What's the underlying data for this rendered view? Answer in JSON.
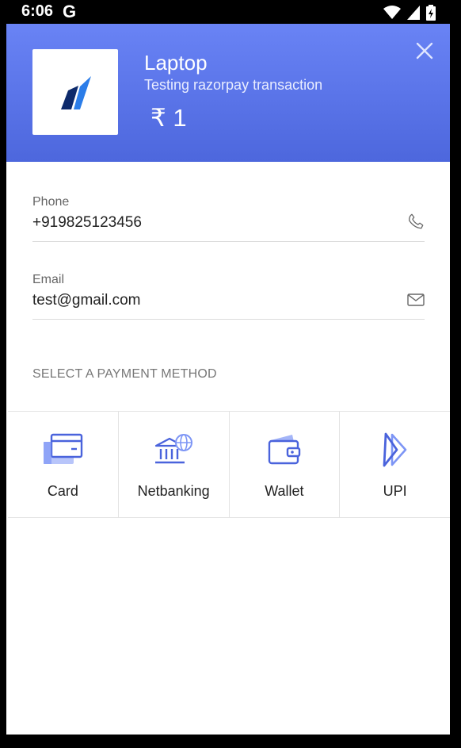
{
  "status_bar": {
    "time": "6:06",
    "g_logo": "G"
  },
  "header": {
    "product_name": "Laptop",
    "description": "Testing razorpay transaction",
    "amount": "₹ 1",
    "brand_color": "#5a74e8"
  },
  "form": {
    "phone": {
      "label": "Phone",
      "value": "+919825123456",
      "icon": "phone-icon"
    },
    "email": {
      "label": "Email",
      "value": "test@gmail.com",
      "icon": "mail-icon"
    }
  },
  "payment": {
    "section_title": "SELECT A PAYMENT METHOD",
    "methods": [
      {
        "label": "Card",
        "icon": "card-icon"
      },
      {
        "label": "Netbanking",
        "icon": "bank-icon"
      },
      {
        "label": "Wallet",
        "icon": "wallet-icon"
      },
      {
        "label": "UPI",
        "icon": "upi-icon"
      }
    ]
  }
}
